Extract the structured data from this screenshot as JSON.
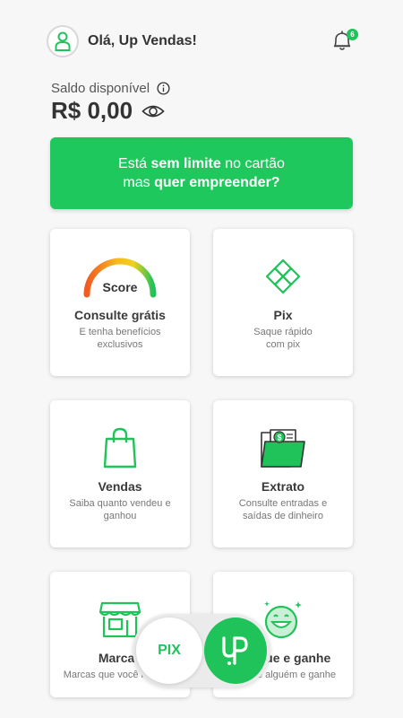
{
  "header": {
    "greeting": "Olá, Up Vendas!",
    "notification_count": "6",
    "avatar_icon": "user-icon",
    "bell_icon": "bell-icon"
  },
  "balance": {
    "label": "Saldo disponível",
    "value": "R$ 0,00"
  },
  "banner": {
    "line1_prefix": "Está ",
    "line1_bold": "sem limite",
    "line1_suffix": " no cartão",
    "line2_prefix": "mas ",
    "line2_bold": "quer empreender?"
  },
  "cards": [
    {
      "icon": "score-gauge-icon",
      "gauge_label": "Score",
      "title": "Consulte grátis",
      "desc": "E tenha benefícios exclusivos"
    },
    {
      "icon": "pix-icon",
      "title": "Pix",
      "desc": "Saque rápido com pix"
    },
    {
      "icon": "shopping-bag-icon",
      "title": "Vendas",
      "desc": "Saiba quanto vendeu e ganhou"
    },
    {
      "icon": "statement-folder-icon",
      "title": "Extrato",
      "desc": "Consulte entradas e saídas de dinheiro"
    },
    {
      "icon": "storefront-icon",
      "title": "Marcas",
      "desc": "Marcas que você revende"
    },
    {
      "icon": "smile-icon",
      "title": "Indique e ganhe",
      "desc": "Indique alguém e ganhe"
    }
  ],
  "fab": {
    "pix_label": "PIX",
    "up_icon": "up-logo-icon"
  },
  "colors": {
    "accent": "#1fc35a",
    "background": "#f7f7f7"
  }
}
